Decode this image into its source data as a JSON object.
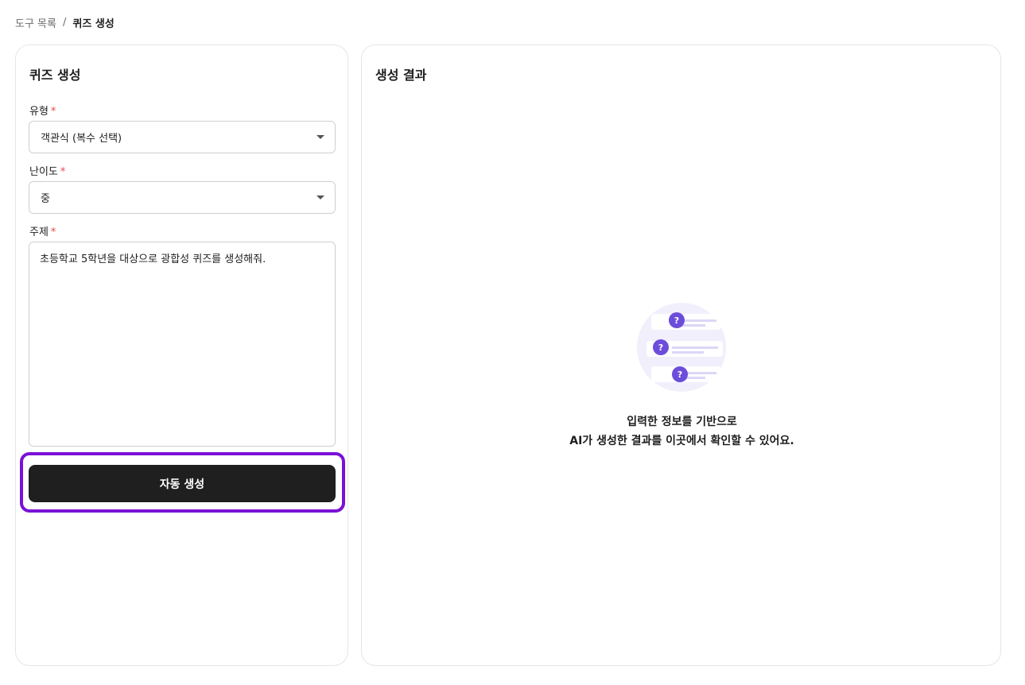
{
  "breadcrumb": {
    "parent": "도구 목록",
    "separator": "/",
    "current": "퀴즈 생성"
  },
  "form": {
    "title": "퀴즈 생성",
    "type": {
      "label": "유형",
      "required_mark": "*",
      "value": "객관식 (복수 선택)"
    },
    "difficulty": {
      "label": "난이도",
      "required_mark": "*",
      "value": "중"
    },
    "topic": {
      "label": "주제",
      "required_mark": "*",
      "value": "초등학교 5학년을 대상으로 광합성 퀴즈를 생성해줘."
    },
    "submit_label": "자동 생성"
  },
  "result": {
    "title": "생성 결과",
    "empty_line1": "입력한 정보를 기반으로",
    "empty_line2": "AI가 생성한 결과를 이곳에서 확인할 수 있어요.",
    "illustration_icon": "quiz-questions-icon"
  },
  "colors": {
    "accent": "#6c4ddb",
    "highlight": "#7b11d6",
    "button_bg": "#1f1f1f",
    "required": "#e5484d"
  }
}
